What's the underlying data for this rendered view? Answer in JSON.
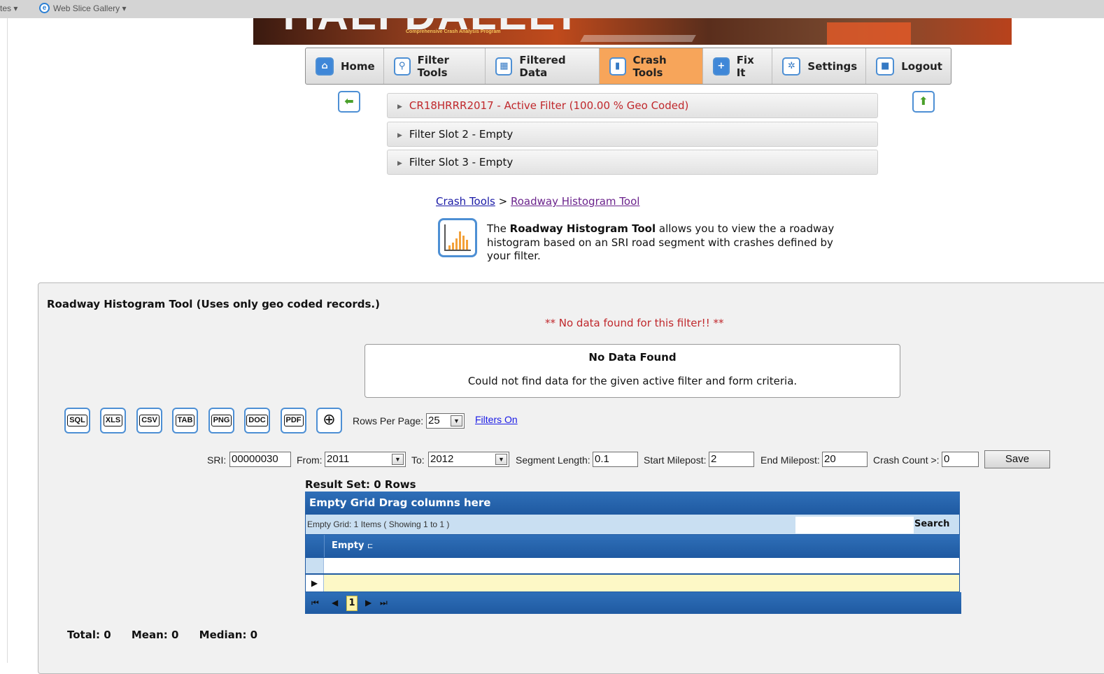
{
  "favorites_bar": {
    "left_label": "tes",
    "left_arrow": "▾",
    "web_slice": "Web Slice Gallery",
    "web_slice_arrow": "▾"
  },
  "banner": {
    "main_text": "TIALI DALELY",
    "sub_text": "Comprehensive Crash Analysis Program"
  },
  "nav": {
    "items": [
      {
        "label": "Home",
        "icon": "home-icon",
        "glyph": "⌂"
      },
      {
        "label": "Filter Tools",
        "icon": "magnifier-icon",
        "glyph": "⚲"
      },
      {
        "label": "Filtered Data",
        "icon": "calculator-icon",
        "glyph": "▦"
      },
      {
        "label": "Crash Tools",
        "icon": "bar-chart-icon",
        "glyph": "▮"
      },
      {
        "label": "Fix It",
        "icon": "plus-icon",
        "glyph": "+"
      },
      {
        "label": "Settings",
        "icon": "gear-icon",
        "glyph": "✲"
      },
      {
        "label": "Logout",
        "icon": "logout-icon",
        "glyph": "■"
      }
    ],
    "active": "Crash Tools",
    "active_color": "#f7a55a"
  },
  "side_buttons": {
    "back_glyph": "⬅",
    "top_glyph": "⬆"
  },
  "filters": [
    {
      "label": "CR18HRRR2017 - Active Filter (100.00 % Geo Coded)",
      "active": true
    },
    {
      "label": "Filter Slot 2 - Empty",
      "active": false
    },
    {
      "label": "Filter Slot 3 - Empty",
      "active": false
    }
  ],
  "breadcrumb": {
    "parent": "Crash Tools",
    "separator": " > ",
    "current": "Roadway Histogram Tool"
  },
  "description": {
    "prefix": "The ",
    "bold": "Roadway Histogram Tool",
    "suffix": " allows you to view the a roadway histogram based on an SRI road segment with crashes defined by your filter."
  },
  "panel": {
    "title": "Roadway Histogram Tool (Uses only geo coded records.)",
    "error": "** No data found for this filter!! **",
    "nodata_title": "No Data Found",
    "nodata_text": "Could not find data for the given active filter and form criteria."
  },
  "export_buttons": [
    "SQL",
    "XLS",
    "CSV",
    "TAB",
    "PNG",
    "DOC",
    "PDF"
  ],
  "globe_glyph": "⊕",
  "rows_per_page": {
    "label": "Rows Per Page:",
    "value": "25"
  },
  "filters_on_link": "Filters On",
  "form": {
    "sri_label": "SRI:",
    "sri_value": "00000030",
    "from_label": "From:",
    "from_value": "2011",
    "to_label": "To:",
    "to_value": "2012",
    "seg_label": "Segment Length:",
    "seg_value": "0.1",
    "start_label": "Start Milepost:",
    "start_value": "2",
    "end_label": "End Milepost:",
    "end_value": "20",
    "crash_label": "Crash Count >:",
    "crash_value": "0",
    "save_label": "Save",
    "dropdown_glyph": "▼"
  },
  "result_set": "Result Set: 0 Rows",
  "grid": {
    "header": "Empty Grid  Drag columns here",
    "info": "Empty Grid: 1 Items ( Showing 1 to 1 )",
    "search_label": "Search",
    "column": "Empty",
    "column_icon": "⊏",
    "row_pointer": "▶",
    "pager": {
      "first": "⏮",
      "prev": "◀",
      "page": "1",
      "next": "▶",
      "last": "⏭"
    }
  },
  "stats": {
    "total": "Total: 0",
    "mean": "Mean: 0",
    "median": "Median: 0"
  }
}
